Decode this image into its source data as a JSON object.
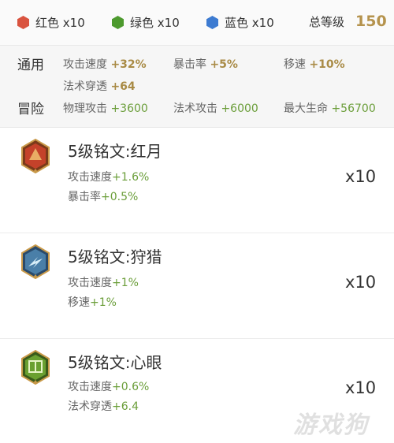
{
  "summary": {
    "red_label": "红色 x10",
    "green_label": "绿色 x10",
    "blue_label": "蓝色 x10",
    "total_label": "总等级",
    "total_value": "150"
  },
  "stats": {
    "general_label": "通用",
    "adventure_label": "冒险",
    "general": [
      {
        "name": "攻击速度",
        "value": "+32%"
      },
      {
        "name": "暴击率",
        "value": "+5%"
      },
      {
        "name": "移速",
        "value": "+10%"
      },
      {
        "name": "法术穿透",
        "value": "+64"
      }
    ],
    "adventure": [
      {
        "name": "物理攻击",
        "value": "+3600"
      },
      {
        "name": "法术攻击",
        "value": "+6000"
      },
      {
        "name": "最大生命",
        "value": "+56700"
      }
    ]
  },
  "runes": [
    {
      "name": "5级铭文:红月",
      "qty": "x10",
      "icon": "red-moon-rune-icon",
      "lines": [
        {
          "label": "攻击速度",
          "value": "+1.6%"
        },
        {
          "label": "暴击率",
          "value": "+0.5%"
        }
      ]
    },
    {
      "name": "5级铭文:狩猎",
      "qty": "x10",
      "icon": "hunt-rune-icon",
      "lines": [
        {
          "label": "攻击速度",
          "value": "+1%"
        },
        {
          "label": "移速",
          "value": "+1%"
        }
      ]
    },
    {
      "name": "5级铭文:心眼",
      "qty": "x10",
      "icon": "mind-eye-rune-icon",
      "lines": [
        {
          "label": "攻击速度",
          "value": "+0.6%"
        },
        {
          "label": "法术穿透",
          "value": "+6.4"
        }
      ]
    }
  ],
  "colors": {
    "red": "#d9533f",
    "green": "#4d9a2e",
    "blue": "#3d7bd1",
    "gold": "#b5934d",
    "stat_green": "#6b9e3a"
  },
  "watermark": "游戏狗"
}
